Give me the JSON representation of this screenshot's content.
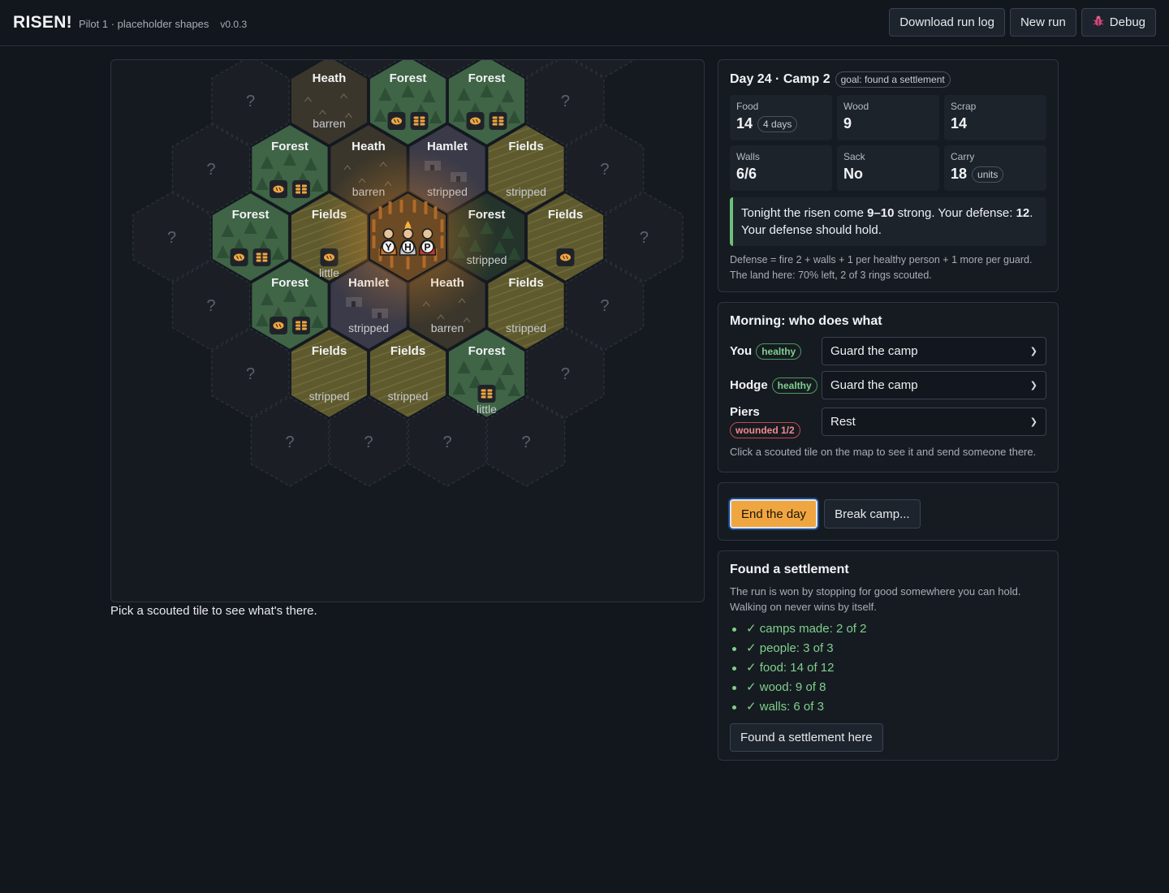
{
  "header": {
    "brand": "RISEN!",
    "subtitle": "Pilot 1 · placeholder shapes",
    "version": "v0.0.3",
    "download_label": "Download run log",
    "new_run_label": "New run",
    "debug_label": "Debug",
    "debug_icon": "bug-icon"
  },
  "map": {
    "hint": "Pick a scouted tile to see what's there.",
    "unknown_label": "?",
    "party_letters": [
      "Y",
      "H",
      "P"
    ],
    "tiles": [
      {
        "q": -2,
        "r": -1,
        "name": "Heath",
        "sub": "barren",
        "icons": []
      },
      {
        "q": -1,
        "r": -1,
        "name": "Forest",
        "sub": "",
        "icons": [
          "food",
          "wood"
        ]
      },
      {
        "q": 0,
        "r": -1,
        "name": "Forest",
        "sub": "",
        "icons": [
          "food",
          "wood"
        ]
      },
      {
        "q": -3,
        "r": 0,
        "name": "Forest",
        "sub": "",
        "icons": [
          "food",
          "wood"
        ]
      },
      {
        "q": -2,
        "r": 0,
        "name": "Heath",
        "sub": "barren",
        "icons": []
      },
      {
        "q": -1,
        "r": 0,
        "name": "Hamlet",
        "sub": "stripped",
        "icons": []
      },
      {
        "q": 0,
        "r": 0,
        "name": "Fields",
        "sub": "stripped",
        "icons": []
      },
      {
        "q": -4,
        "r": 1,
        "name": "Forest",
        "sub": "",
        "icons": [
          "food",
          "wood"
        ]
      },
      {
        "q": -3,
        "r": 1,
        "name": "Fields",
        "sub": "little",
        "icons": [
          "food"
        ]
      },
      {
        "q": -1,
        "r": 1,
        "name": "Forest",
        "sub": "stripped",
        "icons": []
      },
      {
        "q": 0,
        "r": 1,
        "name": "Fields",
        "sub": "",
        "icons": [
          "food"
        ]
      },
      {
        "q": -4,
        "r": 2,
        "name": "Forest",
        "sub": "",
        "icons": [
          "food",
          "wood"
        ]
      },
      {
        "q": -3,
        "r": 2,
        "name": "Hamlet",
        "sub": "stripped",
        "icons": []
      },
      {
        "q": -2,
        "r": 2,
        "name": "Heath",
        "sub": "barren",
        "icons": []
      },
      {
        "q": -1,
        "r": 2,
        "name": "Fields",
        "sub": "stripped",
        "icons": []
      },
      {
        "q": -4,
        "r": 3,
        "name": "Fields",
        "sub": "stripped",
        "icons": []
      },
      {
        "q": -3,
        "r": 3,
        "name": "Fields",
        "sub": "stripped",
        "icons": []
      },
      {
        "q": -2,
        "r": 3,
        "name": "Forest",
        "sub": "little",
        "icons": [
          "wood"
        ]
      }
    ],
    "camp": {
      "q": -2,
      "r": 1
    },
    "unknown": [
      {
        "q": -1,
        "r": -2
      },
      {
        "q": 0,
        "r": -2
      },
      {
        "q": 1,
        "r": -2
      },
      {
        "q": 2,
        "r": -2
      },
      {
        "q": -3,
        "r": -1
      },
      {
        "q": 1,
        "r": -1
      },
      {
        "q": -4,
        "r": 0
      },
      {
        "q": 1,
        "r": 0
      },
      {
        "q": -5,
        "r": 1
      },
      {
        "q": 1,
        "r": 1
      },
      {
        "q": -5,
        "r": 2
      },
      {
        "q": 0,
        "r": 2
      },
      {
        "q": -5,
        "r": 3
      },
      {
        "q": -1,
        "r": 3
      },
      {
        "q": -5,
        "r": 4
      },
      {
        "q": -4,
        "r": 4
      },
      {
        "q": -3,
        "r": 4
      },
      {
        "q": -2,
        "r": 4
      }
    ],
    "colors": {
      "Forest": "#3f6446",
      "Fields": "#5e5a2e",
      "Heath": "#3a362b",
      "Hamlet": "#3a3a48",
      "unknown": "#1b1f25",
      "camp": "#6b4a24"
    }
  },
  "status": {
    "day_title": "Day 24 · Camp 2",
    "goal_badge": "goal: found a settlement",
    "stats": [
      {
        "label": "Food",
        "value": "14",
        "badge": "4 days"
      },
      {
        "label": "Wood",
        "value": "9",
        "badge": ""
      },
      {
        "label": "Scrap",
        "value": "14",
        "badge": ""
      },
      {
        "label": "Walls",
        "value": "6/6",
        "badge": ""
      },
      {
        "label": "Sack",
        "value": "No",
        "badge": ""
      },
      {
        "label": "Carry",
        "value": "18",
        "badge": "units"
      }
    ],
    "alert_pre": "Tonight the risen come ",
    "alert_strength": "9–10",
    "alert_mid": " strong. Your defense: ",
    "alert_defense": "12",
    "alert_post": ". Your defense should hold.",
    "note_defense": "Defense = fire 2 + walls + 1 per healthy person + 1 more per guard.",
    "note_land": "The land here: 70% left, 2 of 3 rings scouted."
  },
  "morning": {
    "title": "Morning: who does what",
    "people": [
      {
        "name": "You",
        "status": "healthy",
        "status_kind": "green",
        "task": "Guard the camp"
      },
      {
        "name": "Hodge",
        "status": "healthy",
        "status_kind": "green",
        "task": "Guard the camp"
      },
      {
        "name": "Piers",
        "status": "wounded 1/2",
        "status_kind": "red",
        "task": "Rest"
      }
    ],
    "hint": "Click a scouted tile on the map to see it and send someone there."
  },
  "actions": {
    "end_day": "End the day",
    "break_camp": "Break camp..."
  },
  "settlement": {
    "title": "Found a settlement",
    "desc": "The run is won by stopping for good somewhere you can hold. Walking on never wins by itself.",
    "checks": [
      "✓ camps made: 2 of 2",
      "✓ people: 3 of 3",
      "✓ food: 14 of 12",
      "✓ wood: 9 of 8",
      "✓ walls: 6 of 3"
    ],
    "found_button": "Found a settlement here"
  }
}
